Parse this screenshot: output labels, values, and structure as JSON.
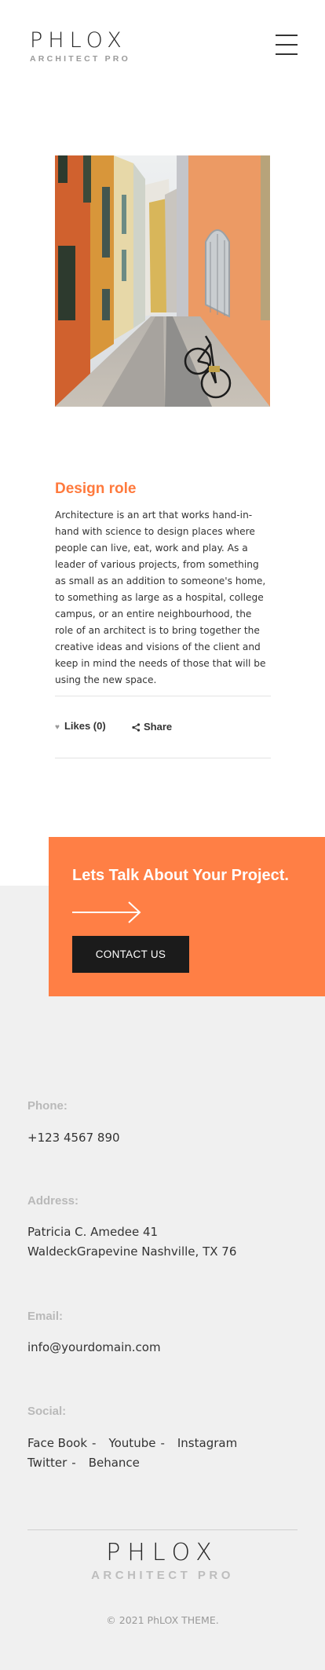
{
  "brand": {
    "name": "PHLOX",
    "tagline": "ARCHITECT PRO"
  },
  "icons": {
    "menu": "hamburger-menu-icon",
    "heart": "heart-icon",
    "share": "share-icon",
    "arrow": "arrow-right-icon"
  },
  "colors": {
    "accent": "#ff7f45",
    "dark_button": "#1b1b1b",
    "footer_bg": "#f0f0f0"
  },
  "post": {
    "title": "Design role",
    "body": "Architecture is an art that works hand-in-hand with science to design places where people can live, eat, work and play. As a leader of various projects, from something as small as an addition to someone's home, to something as large as a hospital, college campus, or an entire neighbourhood, the role of an architect is to bring together the creative ideas and visions of the client and keep in mind the needs of those that will be using the new space.",
    "likes_label": "Likes (0)",
    "share_label": "Share"
  },
  "cta": {
    "title": "Lets Talk About Your Project.",
    "button_label": "CONTACT US"
  },
  "contact": {
    "phone_label": "Phone:",
    "phone": "+123 4567 890",
    "address_label": "Address:",
    "address": "Patricia C. Amedee 41 WaldeckGrapevine Nashville, TX 76",
    "email_label": "Email:",
    "email": "info@yourdomain.com",
    "social_label": "Social:",
    "social": [
      {
        "label": "Face Book",
        "sep": "-"
      },
      {
        "label": "Youtube",
        "sep": "-"
      },
      {
        "label": "Instagram",
        "sep": ""
      },
      {
        "label": "Twitter",
        "sep": "-"
      },
      {
        "label": "Behance",
        "sep": ""
      }
    ]
  },
  "footer": {
    "logo_name": "PHLOX",
    "logo_tagline": "ARCHITECT PRO",
    "copyright": "© 2021 PhLOX THEME."
  }
}
